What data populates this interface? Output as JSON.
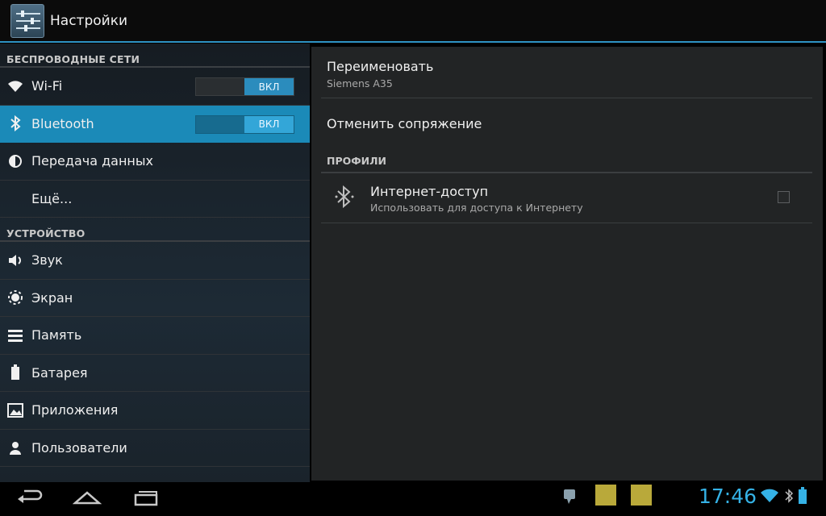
{
  "app": {
    "title": "Настройки"
  },
  "left": {
    "sections": [
      {
        "header": "БЕСПРОВОДНЫЕ СЕТИ"
      },
      {
        "header": "УСТРОЙСТВО"
      }
    ],
    "items": [
      {
        "label": "Wi-Fi",
        "icon": "wifi-icon",
        "toggle": "ВКЛ"
      },
      {
        "label": "Bluetooth",
        "icon": "bluetooth-icon",
        "toggle": "ВКЛ",
        "selected": true
      },
      {
        "label": "Передача данных",
        "icon": "data-usage-icon"
      },
      {
        "label": "Ещё..."
      },
      {
        "label": "Звук",
        "icon": "volume-icon"
      },
      {
        "label": "Экран",
        "icon": "brightness-icon"
      },
      {
        "label": "Память",
        "icon": "storage-icon"
      },
      {
        "label": "Батарея",
        "icon": "battery-icon"
      },
      {
        "label": "Приложения",
        "icon": "apps-icon"
      },
      {
        "label": "Пользователи",
        "icon": "users-icon"
      }
    ]
  },
  "right": {
    "rename": {
      "title": "Переименовать",
      "subtitle": "Siemens A35"
    },
    "unpair": {
      "title": "Отменить сопряжение"
    },
    "profiles_header": "ПРОФИЛИ",
    "internet": {
      "title": "Интернет-доступ",
      "subtitle": "Использовать для доступа к Интернету",
      "checked": false
    }
  },
  "statusbar": {
    "time": "17:46"
  },
  "colors": {
    "accent": "#33b5e5",
    "selected": "#1b8ab8"
  }
}
